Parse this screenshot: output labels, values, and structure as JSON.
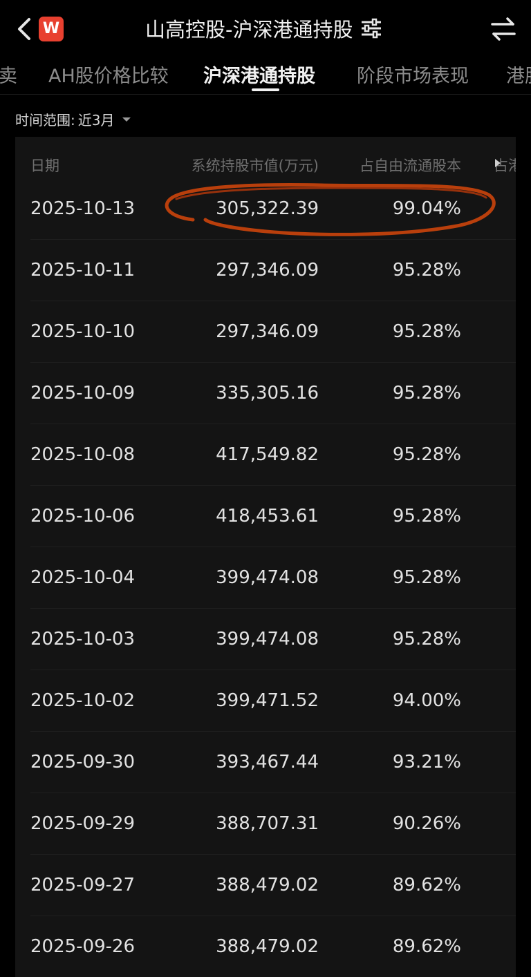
{
  "header": {
    "title": "山高控股-沪深港通持股",
    "logo_text": "W",
    "icons": [
      "back-arrow-icon",
      "filter-sliders-icon",
      "swap-arrows-icon"
    ]
  },
  "tabs": [
    {
      "label": "卖",
      "active": false
    },
    {
      "label": "AH股价格比较",
      "active": false
    },
    {
      "label": "沪深港通持股",
      "active": true
    },
    {
      "label": "阶段市场表现",
      "active": false
    },
    {
      "label": "港股",
      "active": false
    }
  ],
  "filter": {
    "label": "时间范围:",
    "value": "近3月"
  },
  "table": {
    "columns": [
      "日期",
      "系统持股市值(万元)",
      "占自由流通股本",
      "占港"
    ],
    "rows": [
      [
        "2025-10-13",
        "305,322.39",
        "99.04%"
      ],
      [
        "2025-10-11",
        "297,346.09",
        "95.28%"
      ],
      [
        "2025-10-10",
        "297,346.09",
        "95.28%"
      ],
      [
        "2025-10-09",
        "335,305.16",
        "95.28%"
      ],
      [
        "2025-10-08",
        "417,549.82",
        "95.28%"
      ],
      [
        "2025-10-06",
        "418,453.61",
        "95.28%"
      ],
      [
        "2025-10-04",
        "399,474.08",
        "95.28%"
      ],
      [
        "2025-10-03",
        "399,474.08",
        "95.28%"
      ],
      [
        "2025-10-02",
        "399,471.52",
        "94.00%"
      ],
      [
        "2025-09-30",
        "393,467.44",
        "93.21%"
      ],
      [
        "2025-09-29",
        "388,707.31",
        "90.26%"
      ],
      [
        "2025-09-27",
        "388,479.02",
        "89.62%"
      ],
      [
        "2025-09-26",
        "388,479.02",
        "89.62%"
      ]
    ]
  },
  "colors": {
    "background": "#000000",
    "table_bg": "#141414",
    "logo_red": "#e8402f",
    "annotation_orange": "#c2410c"
  }
}
